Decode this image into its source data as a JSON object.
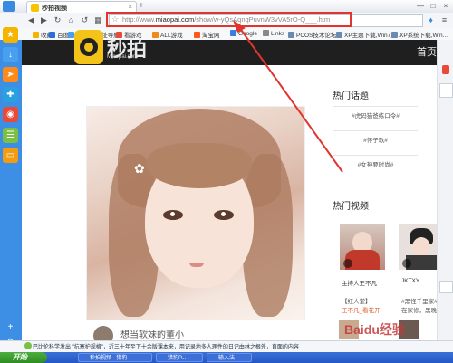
{
  "browser": {
    "tab_title": "秒拍视频",
    "new_tab": "+",
    "url_prefix": "http://www.",
    "url_domain": "miaopai.com",
    "url_path": "/show/w-yQsAqnqPuvnW3vVA5rO-Q___.htm",
    "window_buttons": [
      "—",
      "□",
      "×"
    ]
  },
  "bookmarks": [
    {
      "label": "收藏",
      "color": "#f4b400"
    },
    {
      "label": "百度",
      "color": "#2b6fdc"
    },
    {
      "label": "hao123网址导航",
      "color": "#4aa0f0"
    },
    {
      "label": "看游戏",
      "color": "#e84a3a"
    },
    {
      "label": "ALL游戏",
      "color": "#f08a1a"
    },
    {
      "label": "淘宝网",
      "color": "#ff5a1a"
    },
    {
      "label": "Google",
      "color": "#3b7fe0"
    },
    {
      "label": "Links",
      "color": "#888888"
    },
    {
      "label": "PCOS技术论坛",
      "color": "#6a8ab0"
    },
    {
      "label": "XP主题下载,Win7主...",
      "color": "#6a8ab0"
    },
    {
      "label": "XP系统下载,Win...",
      "color": "#6a8ab0"
    }
  ],
  "site": {
    "logo_name": "秒拍",
    "logo_sub": "Miaopai.com",
    "nav_home": "首页",
    "video_title": "想当软妹的董小"
  },
  "hot_topics": {
    "title": "热门话题",
    "items": [
      "#虎码猫爸练口令#",
      "#怀子歌#",
      "#女神要时尚#"
    ]
  },
  "hot_videos": {
    "title": "热门视频",
    "items": [
      {
        "caption": "主持人王不凡",
        "sub": "【红人堂】",
        "sub2": "王不凡_看花开"
      },
      {
        "caption": "JKTXY",
        "sub": "#黑怪千里家#",
        "sub2": "在家修，黑晚在"
      }
    ]
  },
  "status": {
    "text": "巴比伦科学发出 \"抗塞护规格\"，近三十年至下十余版课本来，用记录地多人理性的日记由林之根外，直面的内容"
  },
  "taskbar": {
    "start": "开始",
    "tasks": [
      "秒拍视频 - 猎豹",
      "猎豹P...",
      "输入法"
    ]
  },
  "watermark": "Baidu经验"
}
